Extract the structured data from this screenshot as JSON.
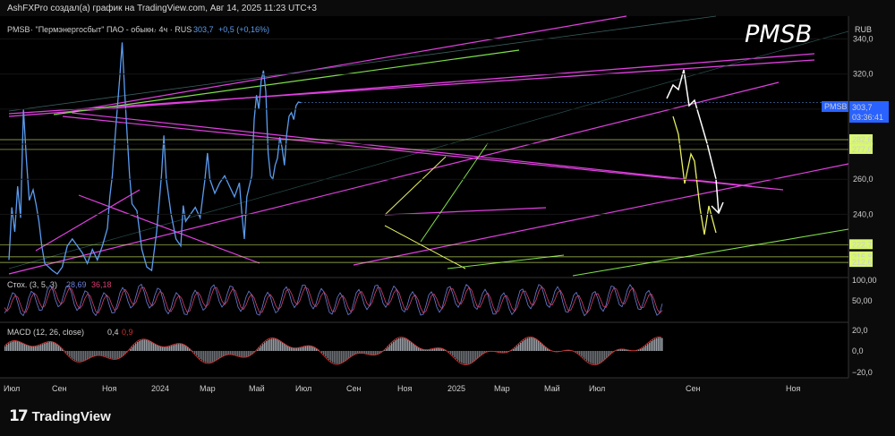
{
  "caption": "AshFXPro создал(а) график на TradingView.com, Авг 14, 2025 11:23 UTC+3",
  "header": {
    "symbol": "PMSB",
    "company": "· \"Пермэнергосбыт\" ПАО - обыкн.",
    "timeframe": "· 4ч · RUS",
    "last": "303,7",
    "change": "+0,5 (+0,16%)",
    "currency": "RUB"
  },
  "watermark_ticker": "PMSB",
  "price_tag": {
    "symbol": "PMSB",
    "value": "303,7",
    "countdown": "03:36:41"
  },
  "level_tags": [
    "282,6",
    "277,0",
    "222,7",
    "215,8",
    "212,6"
  ],
  "stoch": {
    "label": "Стох. (3, 5, 3)",
    "k": "28,69",
    "d": "36,18",
    "axis": [
      "100,00",
      "50,00"
    ]
  },
  "macd": {
    "label": "MACD (12, 26, close)",
    "macd": "0,4",
    "signal": "0,9",
    "axis": [
      "20,0",
      "0,0",
      "−20,0"
    ]
  },
  "time_axis": [
    "Июл",
    "Сен",
    "Ноя",
    "2024",
    "Мар",
    "Май",
    "Июл",
    "Сен",
    "Ноя",
    "2025",
    "Мар",
    "Май",
    "Июл",
    "Сен",
    "Ноя"
  ],
  "brand": "TradingView",
  "colors": {
    "price": "#5b9cf0",
    "magenta": "#e040e0",
    "green": "#7ee04a",
    "yellow": "#e8f060",
    "level": "#d8f870",
    "stochK": "#6a7fd8",
    "stochD": "#d24070",
    "macdLine": "#d03030"
  },
  "chart_data": [
    {
      "type": "line",
      "title": "",
      "x": [
        "Июл",
        "Сен",
        "Ноя",
        "2024",
        "Мар",
        "Май",
        "Июл",
        "Сен",
        "Ноя",
        "2025",
        "Мар",
        "Май",
        "Июл",
        "Сен",
        "Ноя"
      ],
      "y_ticks": [
        340,
        320,
        300,
        280,
        260,
        240
      ],
      "ylim": [
        205,
        352
      ],
      "series": [
        {
          "name": "PMSB",
          "values": [
            [
              0,
              214
            ],
            [
              0.06,
              244
            ],
            [
              0.12,
              230
            ],
            [
              0.18,
              256
            ],
            [
              0.24,
              238
            ],
            [
              0.3,
              300
            ],
            [
              0.36,
              272
            ],
            [
              0.42,
              248
            ],
            [
              0.5,
              254
            ],
            [
              0.56,
              246
            ],
            [
              0.62,
              236
            ],
            [
              0.68,
              222
            ],
            [
              0.74,
              212
            ],
            [
              0.82,
              210
            ],
            [
              0.9,
              208
            ],
            [
              1.0,
              206
            ],
            [
              1.1,
              210
            ],
            [
              1.2,
              222
            ],
            [
              1.3,
              226
            ],
            [
              1.4,
              222
            ],
            [
              1.5,
              218
            ],
            [
              1.6,
              212
            ],
            [
              1.7,
              220
            ],
            [
              1.8,
              214
            ],
            [
              1.9,
              222
            ],
            [
              2.0,
              232
            ],
            [
              2.05,
              250
            ],
            [
              2.1,
              262
            ],
            [
              2.15,
              282
            ],
            [
              2.2,
              300
            ],
            [
              2.25,
              318
            ],
            [
              2.3,
              338
            ],
            [
              2.35,
              310
            ],
            [
              2.4,
              286
            ],
            [
              2.45,
              262
            ],
            [
              2.5,
              246
            ],
            [
              2.6,
              242
            ],
            [
              2.7,
              220
            ],
            [
              2.8,
              210
            ],
            [
              2.9,
              208
            ],
            [
              3.0,
              230
            ],
            [
              3.1,
              262
            ],
            [
              3.15,
              285
            ],
            [
              3.2,
              260
            ],
            [
              3.3,
              240
            ],
            [
              3.4,
              226
            ],
            [
              3.5,
              222
            ],
            [
              3.55,
              245
            ],
            [
              3.6,
              236
            ],
            [
              3.7,
              240
            ],
            [
              3.8,
              244
            ],
            [
              3.9,
              238
            ],
            [
              4.0,
              260
            ],
            [
              4.05,
              275
            ],
            [
              4.1,
              260
            ],
            [
              4.2,
              252
            ],
            [
              4.3,
              258
            ],
            [
              4.4,
              262
            ],
            [
              4.5,
              256
            ],
            [
              4.6,
              250
            ],
            [
              4.7,
              258
            ],
            [
              4.75,
              240
            ],
            [
              4.8,
              226
            ],
            [
              4.85,
              250
            ],
            [
              4.9,
              256
            ],
            [
              4.95,
              262
            ],
            [
              5.0,
              294
            ],
            [
              5.05,
              308
            ],
            [
              5.1,
              300
            ],
            [
              5.15,
              316
            ],
            [
              5.2,
              322
            ],
            [
              5.25,
              310
            ],
            [
              5.3,
              275
            ],
            [
              5.35,
              262
            ],
            [
              5.4,
              260
            ],
            [
              5.45,
              268
            ],
            [
              5.5,
              272
            ],
            [
              5.55,
              284
            ],
            [
              5.6,
              278
            ],
            [
              5.65,
              268
            ],
            [
              5.7,
              286
            ],
            [
              5.75,
              296
            ],
            [
              5.8,
              298
            ],
            [
              5.85,
              294
            ],
            [
              5.9,
              302
            ],
            [
              5.95,
              304
            ],
            [
              6.0,
              303.7
            ]
          ]
        }
      ],
      "horizontal_levels": [
        282.6,
        277.0,
        222.7,
        215.8,
        212.6
      ],
      "current_price": 303.7
    },
    {
      "type": "line",
      "title": "Стох. (3, 5, 3)",
      "ylim": [
        0,
        100
      ],
      "series": [
        {
          "name": "28,69"
        },
        {
          "name": "36,18"
        }
      ]
    },
    {
      "type": "area",
      "title": "MACD (12, 26, close)",
      "ylim": [
        -25,
        25
      ],
      "series": [
        {
          "name": "0,4"
        },
        {
          "name": "0,9"
        }
      ]
    }
  ]
}
